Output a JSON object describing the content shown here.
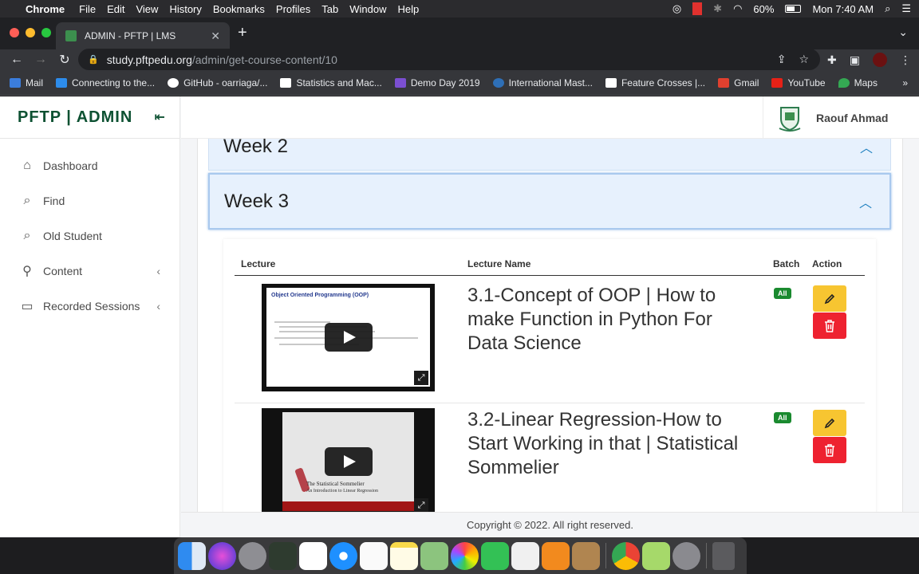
{
  "menubar": {
    "app": "Chrome",
    "items": [
      "File",
      "Edit",
      "View",
      "History",
      "Bookmarks",
      "Profiles",
      "Tab",
      "Window",
      "Help"
    ],
    "battery": "60%",
    "clock": "Mon 7:40 AM"
  },
  "browser": {
    "tab_title": "ADMIN - PFTP | LMS",
    "url_host": "study.pftpedu.org",
    "url_path": "/admin/get-course-content/10"
  },
  "bookmarks": [
    {
      "label": "Mail",
      "color": "#3b7ddd"
    },
    {
      "label": "Connecting to the...",
      "color": "#2d8ceb"
    },
    {
      "label": "GitHub - oarriaga/...",
      "color": "#ffffff"
    },
    {
      "label": "Statistics and Mac...",
      "color": "#ffffff"
    },
    {
      "label": "Demo Day 2019",
      "color": "#7b4fd1"
    },
    {
      "label": "International Mast...",
      "color": "#2e6fb7"
    },
    {
      "label": "Feature Crosses |...",
      "color": "#ffffff"
    },
    {
      "label": "Gmail",
      "color": "#e0402f"
    },
    {
      "label": "YouTube",
      "color": "#e62117"
    },
    {
      "label": "Maps",
      "color": "#34a853"
    }
  ],
  "sidebar": {
    "brand": "PFTP | ADMIN",
    "items": [
      {
        "label": "Dashboard"
      },
      {
        "label": "Find"
      },
      {
        "label": "Old Student"
      },
      {
        "label": "Content"
      },
      {
        "label": "Recorded Sessions"
      }
    ]
  },
  "header": {
    "user_name": "Raouf Ahmad"
  },
  "weeks": [
    {
      "label": "Week 2"
    },
    {
      "label": "Week 3"
    }
  ],
  "table": {
    "columns": [
      "Lecture",
      "Lecture Name",
      "Batch",
      "Action"
    ],
    "rows": [
      {
        "name": "3.1-Concept of OOP | How to make Function in Python For Data Science",
        "batch": "All",
        "thumb_title": "Object Oriented Programming (OOP)"
      },
      {
        "name": "3.2-Linear Regression-How to Start Working in that | Statistical Sommelier",
        "batch": "All",
        "thumb_title": "The Statistical Sommelier",
        "thumb_subtitle": "An Introduction to Linear Regression"
      }
    ]
  },
  "footer": {
    "text": "Copyright © 2022. All right reserved."
  },
  "colors": {
    "brand": "#0d5132",
    "edit": "#f7c531",
    "delete": "#ee2230",
    "badge": "#1a8a2f",
    "week_bg": "#e7f1fd"
  }
}
